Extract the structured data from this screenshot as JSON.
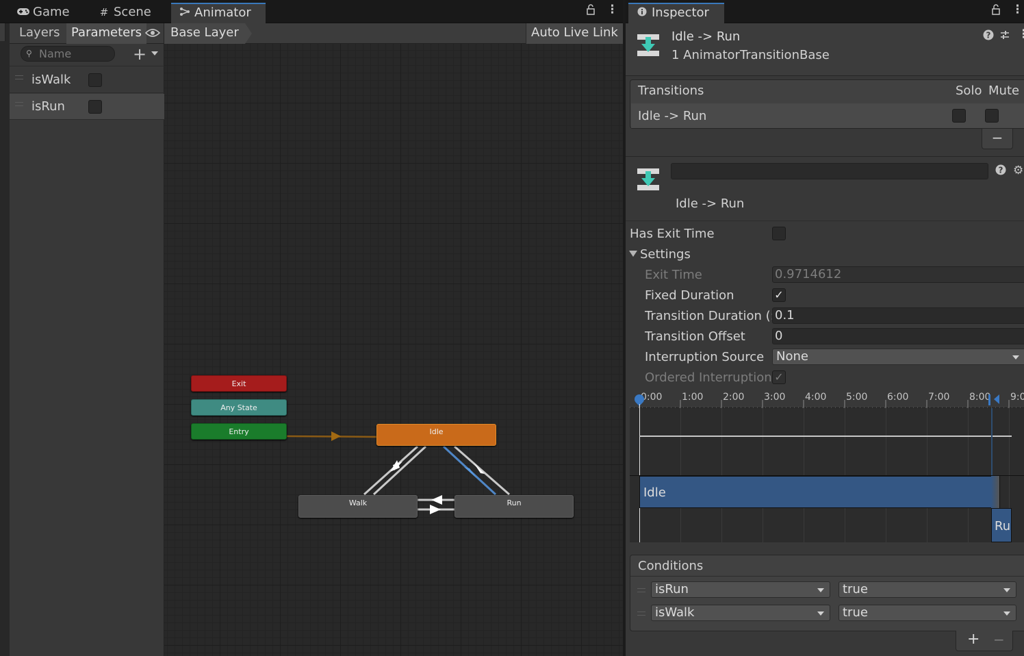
{
  "tabs_left": [
    {
      "label": "Game",
      "icon": "gamepad-icon"
    },
    {
      "label": "Scene",
      "icon": "grid-icon"
    },
    {
      "label": "Animator",
      "icon": "animator-icon"
    }
  ],
  "tabs_right": [
    {
      "label": "Inspector",
      "icon": "info-icon"
    }
  ],
  "left_panel": {
    "tabs": [
      "Layers",
      "Parameters"
    ],
    "search_placeholder": "Name",
    "parameters": [
      {
        "name": "isWalk",
        "value": false
      },
      {
        "name": "isRun",
        "value": false
      }
    ]
  },
  "graph": {
    "breadcrumb": "Base Layer",
    "auto_live_link": "Auto Live Link",
    "nodes": {
      "exit": "Exit",
      "any_state": "Any State",
      "entry": "Entry",
      "idle": "Idle",
      "walk": "Walk",
      "run": "Run"
    }
  },
  "inspector": {
    "title": "Idle -> Run",
    "subtitle": "1 AnimatorTransitionBase",
    "transitions_header": "Transitions",
    "solo": "Solo",
    "mute": "Mute",
    "transition_item": "Idle -> Run",
    "transition_name_field": "",
    "transition_label": "Idle -> Run",
    "has_exit_time_label": "Has Exit Time",
    "settings_label": "Settings",
    "settings": {
      "exit_time_label": "Exit Time",
      "exit_time_value": "0.9714612",
      "fixed_duration_label": "Fixed Duration",
      "transition_duration_label": "Transition Duration (:",
      "transition_duration_value": "0.1",
      "transition_offset_label": "Transition Offset",
      "transition_offset_value": "0",
      "interruption_source_label": "Interruption Source",
      "interruption_source_value": "None",
      "ordered_interruption_label": "Ordered Interruption"
    },
    "timeline": {
      "ticks": [
        "0:00",
        "1:00",
        "2:00",
        "3:00",
        "4:00",
        "5:00",
        "6:00",
        "7:00",
        "8:00",
        "9:0"
      ],
      "idle_clip": "Idle",
      "run_clip": "Run"
    },
    "conditions_header": "Conditions",
    "conditions": [
      {
        "param": "isRun",
        "value": "true"
      },
      {
        "param": "isWalk",
        "value": "true"
      }
    ],
    "add": "+",
    "remove": "−"
  },
  "colors": {
    "accent": "#3a79bb",
    "idle_node": "#c8661a",
    "exit_node": "#a01d1d",
    "entry_node": "#1b7a2c",
    "any_state_node": "#3d8a80",
    "walk_run_node": "#4a4a4a"
  }
}
